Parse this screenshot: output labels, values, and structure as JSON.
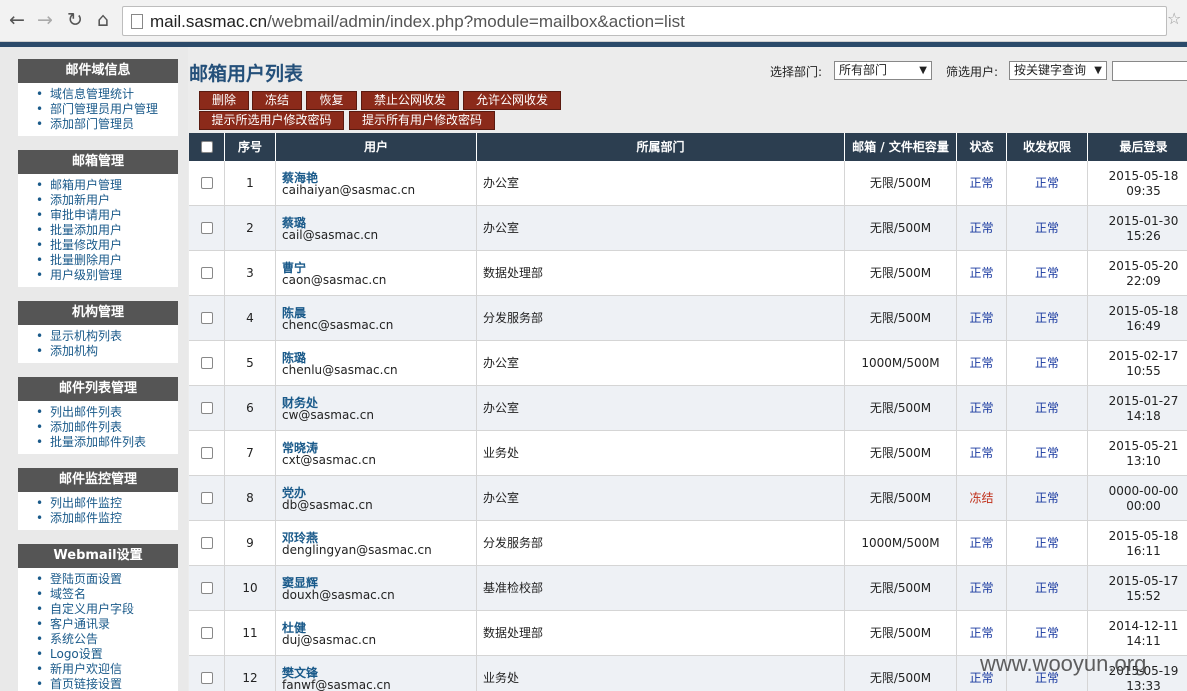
{
  "browser": {
    "url_host": "mail.sasmac.cn",
    "url_path": "/webmail/admin/index.php?module=mailbox&action=list"
  },
  "sidebar": {
    "sections": [
      {
        "title": "邮件域信息",
        "items": [
          "域信息管理统计",
          "部门管理员用户管理",
          "添加部门管理员"
        ]
      },
      {
        "title": "邮箱管理",
        "items": [
          "邮箱用户管理",
          "添加新用户",
          "审批申请用户",
          "批量添加用户",
          "批量修改用户",
          "批量删除用户",
          "用户级别管理"
        ]
      },
      {
        "title": "机构管理",
        "items": [
          "显示机构列表",
          "添加机构"
        ]
      },
      {
        "title": "邮件列表管理",
        "items": [
          "列出邮件列表",
          "添加邮件列表",
          "批量添加邮件列表"
        ]
      },
      {
        "title": "邮件监控管理",
        "items": [
          "列出邮件监控",
          "添加邮件监控"
        ]
      },
      {
        "title": "Webmail设置",
        "items": [
          "登陆页面设置",
          "域签名",
          "自定义用户字段",
          "客户通讯录",
          "系统公告",
          "Logo设置",
          "新用户欢迎信",
          "首页链接设置"
        ]
      }
    ]
  },
  "main": {
    "title": "邮箱用户列表",
    "dept_label": "选择部门:",
    "dept_value": "所有部门",
    "filter_label": "筛选用户:",
    "filter_value": "按关键字查询"
  },
  "buttons": {
    "delete": "删除",
    "freeze": "冻结",
    "restore": "恢复",
    "forbid_public": "禁止公网收发",
    "allow_public": "允许公网收发",
    "prompt_selected": "提示所选用户修改密码",
    "prompt_all": "提示所有用户修改密码"
  },
  "table": {
    "headers": [
      "序号",
      "用户",
      "所属部门",
      "邮箱 / 文件柜容量",
      "状态",
      "收发权限",
      "最后登录"
    ],
    "rows": [
      {
        "no": "1",
        "name": "蔡海艳",
        "email": "caihaiyan@sasmac.cn",
        "dept": "办公室",
        "quota": "无限/500M",
        "status": "正常",
        "perm": "正常",
        "date": "2015-05-18",
        "time": "09:35"
      },
      {
        "no": "2",
        "name": "蔡璐",
        "email": "cail@sasmac.cn",
        "dept": "办公室",
        "quota": "无限/500M",
        "status": "正常",
        "perm": "正常",
        "date": "2015-01-30",
        "time": "15:26"
      },
      {
        "no": "3",
        "name": "曹宁",
        "email": "caon@sasmac.cn",
        "dept": "数据处理部",
        "quota": "无限/500M",
        "status": "正常",
        "perm": "正常",
        "date": "2015-05-20",
        "time": "22:09"
      },
      {
        "no": "4",
        "name": "陈晨",
        "email": "chenc@sasmac.cn",
        "dept": "分发服务部",
        "quota": "无限/500M",
        "status": "正常",
        "perm": "正常",
        "date": "2015-05-18",
        "time": "16:49"
      },
      {
        "no": "5",
        "name": "陈璐",
        "email": "chenlu@sasmac.cn",
        "dept": "办公室",
        "quota": "1000M/500M",
        "status": "正常",
        "perm": "正常",
        "date": "2015-02-17",
        "time": "10:55"
      },
      {
        "no": "6",
        "name": "财务处",
        "email": "cw@sasmac.cn",
        "dept": "办公室",
        "quota": "无限/500M",
        "status": "正常",
        "perm": "正常",
        "date": "2015-01-27",
        "time": "14:18"
      },
      {
        "no": "7",
        "name": "常晓涛",
        "email": "cxt@sasmac.cn",
        "dept": "业务处",
        "quota": "无限/500M",
        "status": "正常",
        "perm": "正常",
        "date": "2015-05-21",
        "time": "13:10"
      },
      {
        "no": "8",
        "name": "党办",
        "email": "db@sasmac.cn",
        "dept": "办公室",
        "quota": "无限/500M",
        "status": "冻结",
        "perm": "正常",
        "date": "0000-00-00",
        "time": "00:00"
      },
      {
        "no": "9",
        "name": "邓玲燕",
        "email": "denglingyan@sasmac.cn",
        "dept": "分发服务部",
        "quota": "1000M/500M",
        "status": "正常",
        "perm": "正常",
        "date": "2015-05-18",
        "time": "16:11"
      },
      {
        "no": "10",
        "name": "窦显辉",
        "email": "douxh@sasmac.cn",
        "dept": "基准检校部",
        "quota": "无限/500M",
        "status": "正常",
        "perm": "正常",
        "date": "2015-05-17",
        "time": "15:52"
      },
      {
        "no": "11",
        "name": "杜健",
        "email": "duj@sasmac.cn",
        "dept": "数据处理部",
        "quota": "无限/500M",
        "status": "正常",
        "perm": "正常",
        "date": "2014-12-11",
        "time": "14:11"
      },
      {
        "no": "12",
        "name": "樊文锋",
        "email": "fanwf@sasmac.cn",
        "dept": "业务处",
        "quota": "无限/500M",
        "status": "正常",
        "perm": "正常",
        "date": "2015-05-19",
        "time": "13:33"
      }
    ]
  },
  "watermark": "www.wooyun.org"
}
